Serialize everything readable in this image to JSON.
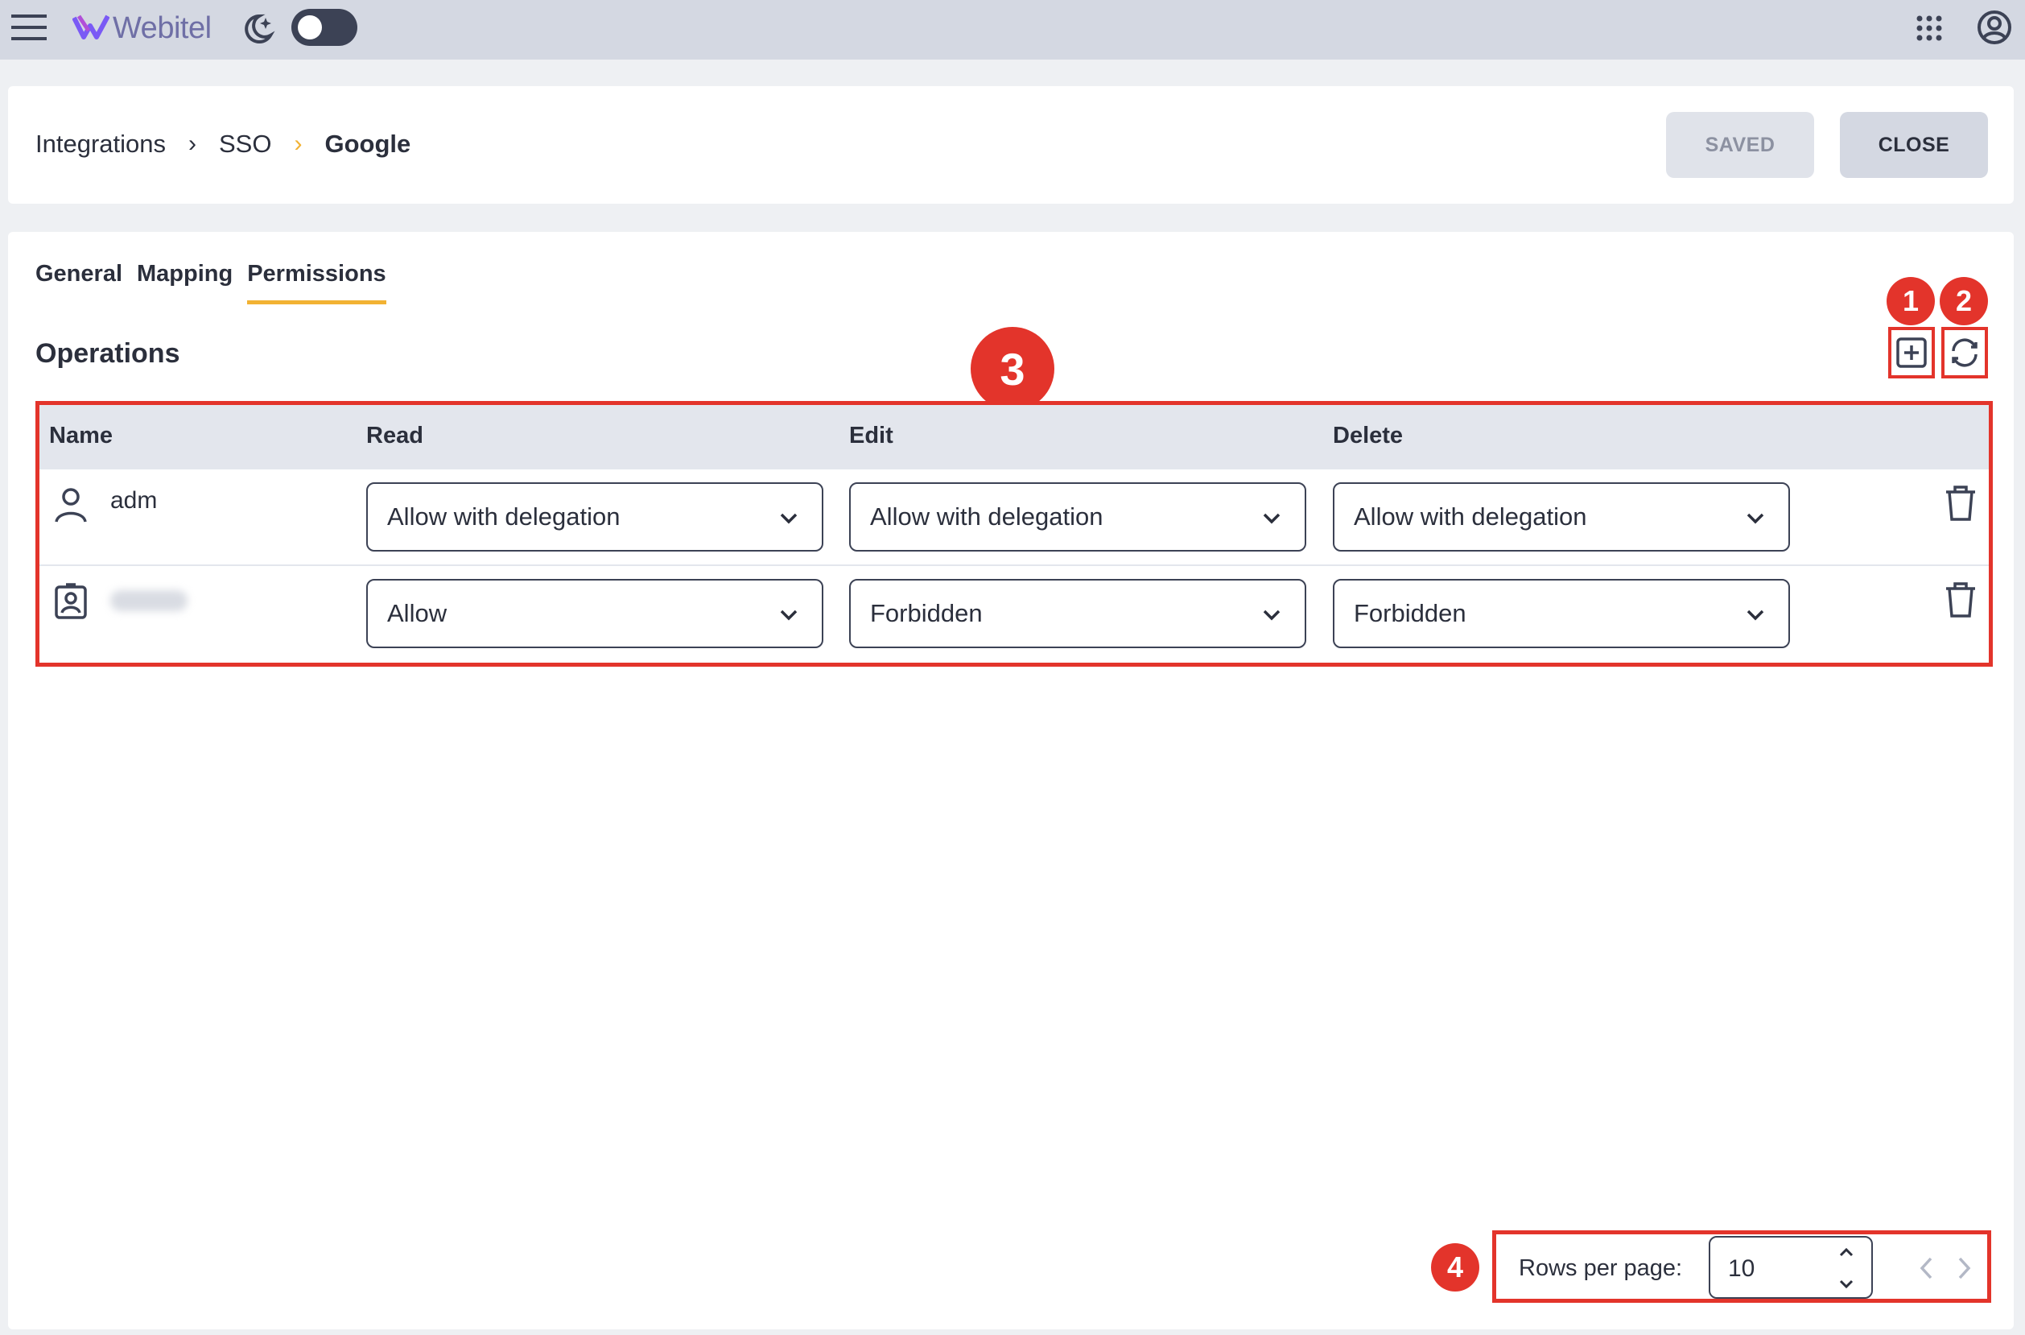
{
  "topbar": {
    "logo_text": "Webitel",
    "menu_icon": "hamburger-icon",
    "theme_icon": "moon-stars-icon",
    "apps_icon": "apps-grid-icon",
    "account_icon": "account-circle-icon",
    "dark_mode": false
  },
  "header": {
    "breadcrumb": [
      "Integrations",
      "SSO",
      "Google"
    ],
    "separator": "›",
    "saved_label": "SAVED",
    "close_label": "CLOSE"
  },
  "tabs": [
    "General",
    "Mapping",
    "Permissions"
  ],
  "active_tab": "Permissions",
  "section": {
    "title": "Operations",
    "add_icon": "add-box-icon",
    "refresh_icon": "refresh-icon"
  },
  "table": {
    "columns": [
      "Name",
      "Read",
      "Edit",
      "Delete"
    ],
    "rows": [
      {
        "icon": "user-icon",
        "name": "adm",
        "read": "Allow with delegation",
        "edit": "Allow with delegation",
        "delete": "Allow with delegation"
      },
      {
        "icon": "badge-icon",
        "name": "",
        "read": "Allow",
        "edit": "Forbidden",
        "delete": "Forbidden"
      }
    ]
  },
  "pagination": {
    "rows_label": "Rows per page:",
    "rows_value": "10"
  },
  "markers": [
    "1",
    "2",
    "3",
    "4"
  ],
  "colors": {
    "accent": "#f2b233",
    "highlight": "#e3342b",
    "topbar": "#d4d8e2",
    "text": "#2b2f3c"
  }
}
